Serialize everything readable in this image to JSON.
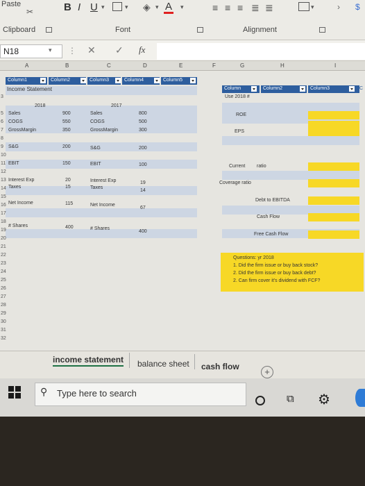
{
  "ribbon": {
    "paste_label": "Paste",
    "bold": "B",
    "italic": "I",
    "underline": "U",
    "clipboard_label": "Clipboard",
    "font_label": "Font",
    "alignment_label": "Alignment",
    "font_color_letter": "A"
  },
  "formula_bar": {
    "name_box": "N18",
    "fx": "fx"
  },
  "columns": [
    "A",
    "B",
    "C",
    "D",
    "E",
    "F",
    "G",
    "H",
    "I"
  ],
  "rows": [
    "1",
    "2",
    "3",
    "4",
    "5",
    "6",
    "7",
    "8",
    "9",
    "10",
    "11",
    "12",
    "13",
    "14",
    "15",
    "16",
    "17",
    "18",
    "19",
    "20",
    "21",
    "22",
    "23",
    "24",
    "25",
    "26",
    "27",
    "28",
    "29",
    "30",
    "31",
    "32",
    "33",
    "34",
    "35"
  ],
  "table_headers": {
    "col1": "Column1",
    "col2": "Column2",
    "col3": "Column3",
    "col4": "Column4",
    "col5": "Column5",
    "g_col": "Column",
    "h_col": "Column2",
    "i_col": "Column3"
  },
  "income_statement": {
    "title": "Income Statement",
    "year_2018": "2018",
    "year_2017": "2017",
    "rows_2018": [
      {
        "label": "Sales",
        "value": "900"
      },
      {
        "label": "COGS",
        "value": "550"
      },
      {
        "label": "GrossMargin",
        "value": "350"
      },
      {
        "label": "S&G",
        "value": "200"
      },
      {
        "label": "EBIT",
        "value": "150"
      },
      {
        "label": "Interest Exp",
        "value": "20"
      },
      {
        "label": "Taxes",
        "value": "15"
      },
      {
        "label": "Net Income",
        "value": "115"
      },
      {
        "label": "# Shares",
        "value": "400"
      }
    ],
    "rows_2017": [
      {
        "label": "Sales",
        "value": "800"
      },
      {
        "label": "COGS",
        "value": "500"
      },
      {
        "label": "GrossMargin",
        "value": "300"
      },
      {
        "label": "S&G",
        "value": "200"
      },
      {
        "label": "EBIT",
        "value": "100"
      },
      {
        "label": "Interest Exp",
        "value": "19"
      },
      {
        "label": "Taxes",
        "value": "14"
      },
      {
        "label": "Net Income",
        "value": "67"
      },
      {
        "label": "# Shares",
        "value": "400"
      }
    ]
  },
  "ratios": {
    "use_label": "Use 2018 #",
    "roe": "ROE",
    "eps": "EPS",
    "current": "Current",
    "ratio": "ratio",
    "coverage": "Coverage ratio",
    "debt_ebitda": "Debt to EBITDA",
    "cash_flow": "Cash Flow",
    "free_cash_flow": "Free Cash Flow"
  },
  "questions": {
    "title": "Questions: yr 2018",
    "q1": "1. Did the firm issue or buy back stock?",
    "q2": "2. Did the firm issue or buy back debt?",
    "q3": "2. Can firm cover it's dividend with FCF?"
  },
  "sheet_tabs": [
    "income statement",
    "balance sheet",
    "cash flow"
  ],
  "taskbar": {
    "search_placeholder": "Type here to search"
  },
  "colors": {
    "header_blue": "#2e5e9e",
    "band_blue": "#cdd6e3",
    "highlight_yellow": "#f7d826"
  }
}
